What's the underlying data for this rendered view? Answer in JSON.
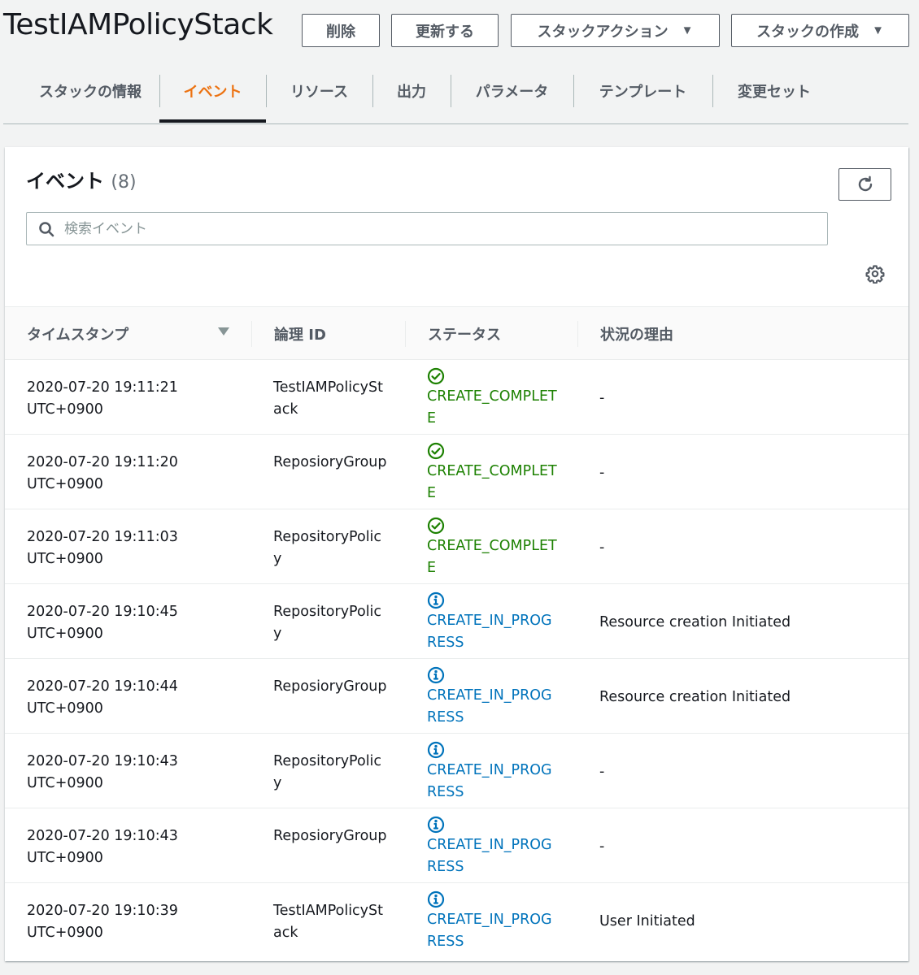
{
  "header": {
    "title": "TestIAMPolicyStack",
    "buttons": {
      "delete": "削除",
      "update": "更新する",
      "stack_actions": "スタックアクション",
      "create_stack": "スタックの作成"
    }
  },
  "tabs": [
    {
      "label": "スタックの情報",
      "active": false
    },
    {
      "label": "イベント",
      "active": true
    },
    {
      "label": "リソース",
      "active": false
    },
    {
      "label": "出力",
      "active": false
    },
    {
      "label": "パラメータ",
      "active": false
    },
    {
      "label": "テンプレート",
      "active": false
    },
    {
      "label": "変更セット",
      "active": false
    }
  ],
  "events_panel": {
    "title": "イベント",
    "count": "(8)",
    "search_placeholder": "検索イベント",
    "columns": {
      "timestamp": "タイムスタンプ",
      "logical_id": "論理 ID",
      "status": "ステータス",
      "reason": "状況の理由"
    },
    "rows": [
      {
        "timestamp": "2020-07-20 19:11:21 UTC+0900",
        "logical_id": "TestIAMPolicyStack",
        "status": "CREATE_COMPLETE",
        "status_kind": "complete",
        "reason": "-"
      },
      {
        "timestamp": "2020-07-20 19:11:20 UTC+0900",
        "logical_id": "ReposioryGroup",
        "status": "CREATE_COMPLETE",
        "status_kind": "complete",
        "reason": "-"
      },
      {
        "timestamp": "2020-07-20 19:11:03 UTC+0900",
        "logical_id": "RepositoryPolicy",
        "status": "CREATE_COMPLETE",
        "status_kind": "complete",
        "reason": "-"
      },
      {
        "timestamp": "2020-07-20 19:10:45 UTC+0900",
        "logical_id": "RepositoryPolicy",
        "status": "CREATE_IN_PROGRESS",
        "status_kind": "in-progress",
        "reason": "Resource creation Initiated"
      },
      {
        "timestamp": "2020-07-20 19:10:44 UTC+0900",
        "logical_id": "ReposioryGroup",
        "status": "CREATE_IN_PROGRESS",
        "status_kind": "in-progress",
        "reason": "Resource creation Initiated"
      },
      {
        "timestamp": "2020-07-20 19:10:43 UTC+0900",
        "logical_id": "RepositoryPolicy",
        "status": "CREATE_IN_PROGRESS",
        "status_kind": "in-progress",
        "reason": "-"
      },
      {
        "timestamp": "2020-07-20 19:10:43 UTC+0900",
        "logical_id": "ReposioryGroup",
        "status": "CREATE_IN_PROGRESS",
        "status_kind": "in-progress",
        "reason": "-"
      },
      {
        "timestamp": "2020-07-20 19:10:39 UTC+0900",
        "logical_id": "TestIAMPolicyStack",
        "status": "CREATE_IN_PROGRESS",
        "status_kind": "in-progress",
        "reason": "User Initiated"
      }
    ]
  },
  "colors": {
    "accent_active_tab": "#ec7211",
    "status_complete": "#1d8102",
    "status_in_progress": "#0073bb"
  },
  "icons": {
    "refresh": "refresh-icon",
    "search": "search-icon",
    "settings": "gear-icon",
    "status_complete": "check-circle-icon",
    "status_in_progress": "info-circle-icon",
    "sort": "sort-caret-down-icon"
  }
}
